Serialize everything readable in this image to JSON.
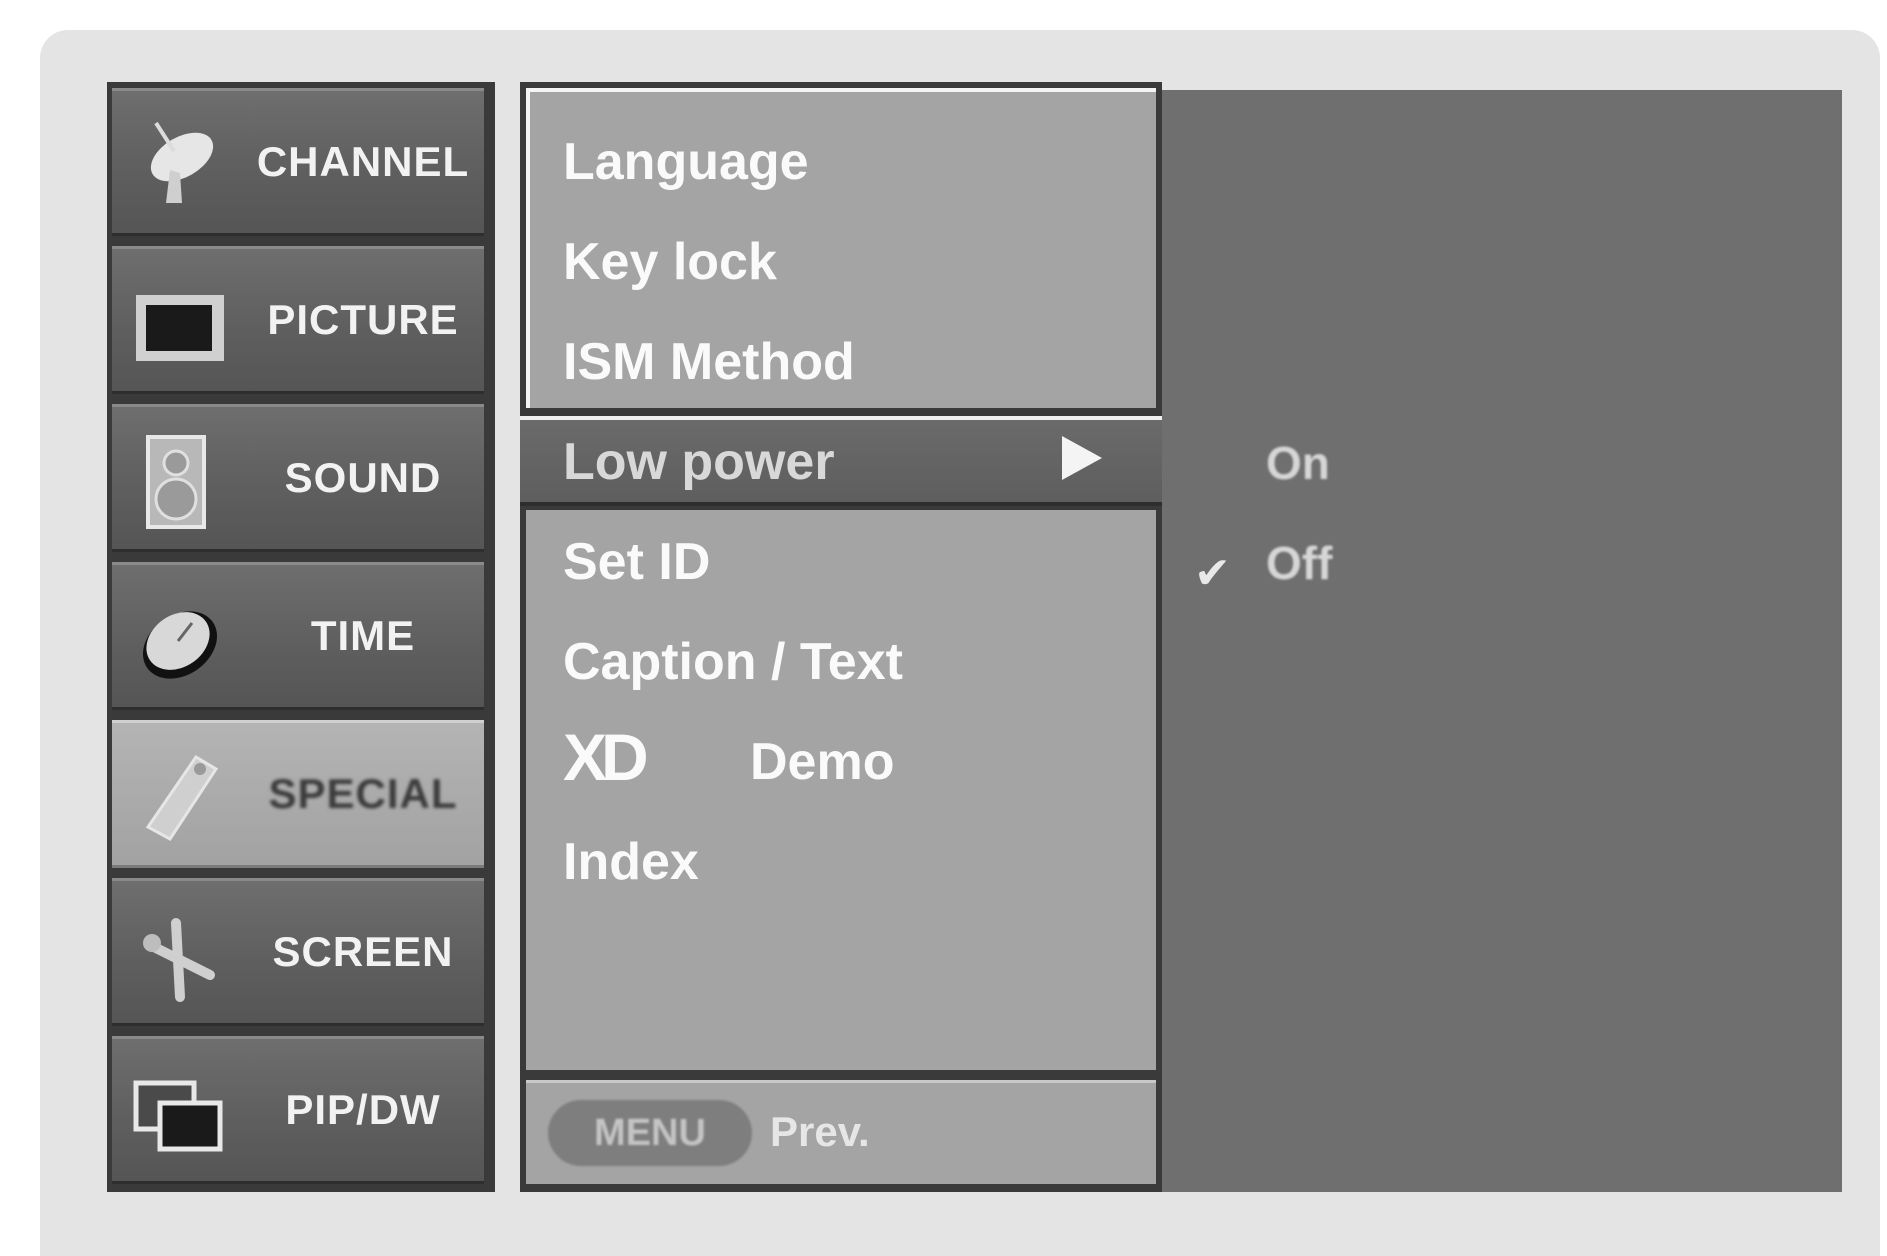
{
  "categories": [
    {
      "label": "CHANNEL",
      "icon": "satellite-dish-icon",
      "active": false
    },
    {
      "label": "PICTURE",
      "icon": "tv-screen-icon",
      "active": false
    },
    {
      "label": "SOUND",
      "icon": "speaker-icon",
      "active": false
    },
    {
      "label": "TIME",
      "icon": "clock-icon",
      "active": false
    },
    {
      "label": "SPECIAL",
      "icon": "tag-icon",
      "active": true
    },
    {
      "label": "SCREEN",
      "icon": "tools-icon",
      "active": false
    },
    {
      "label": "PIP/DW",
      "icon": "pip-windows-icon",
      "active": false
    }
  ],
  "menu": {
    "items": [
      "Language",
      "Key lock",
      "ISM Method",
      "Low power",
      "Set ID",
      "Caption / Text",
      "Demo",
      "Index"
    ],
    "selected": "Low power",
    "xd_logo": "XD"
  },
  "submenu": {
    "options": [
      "On",
      "Off"
    ],
    "checked": "Off"
  },
  "footer": {
    "menu_button": "MENU",
    "prev_label": "Prev."
  },
  "colors": {
    "panel_light": "#a4a4a4",
    "panel_dark": "#6f6f6f",
    "category_bg": "#5f5f5f",
    "category_active": "#a8a8a8"
  }
}
